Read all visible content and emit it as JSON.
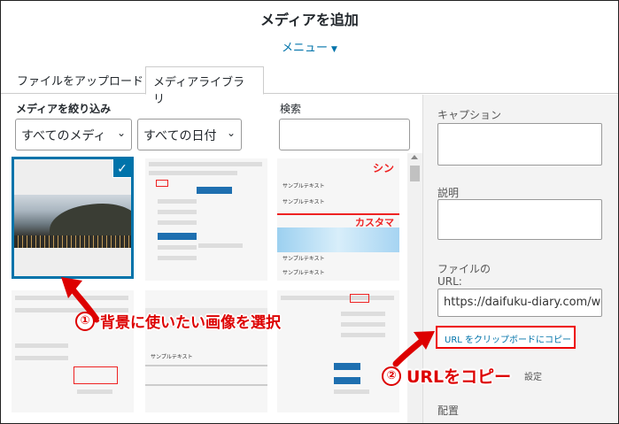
{
  "header": {
    "title": "メディアを追加",
    "menu_label": "メニュー",
    "menu_caret": "▼"
  },
  "tabs": [
    {
      "label": "ファイルをアップロード",
      "active": false
    },
    {
      "label": "メディアライブラリ",
      "active": true
    }
  ],
  "filters": {
    "label": "メディアを絞り込み",
    "type_select": "すべてのメディ",
    "date_select": "すべての日付",
    "chevron": "⌄"
  },
  "search": {
    "label": "検索",
    "value": ""
  },
  "thumbs": {
    "sample_text": "サンプルテキスト",
    "red_heading_1": "シン",
    "red_heading_2": "カスタマ",
    "check_glyph": "✓"
  },
  "sidebar": {
    "caption_label": "キャプション",
    "description_label": "説明",
    "file_url_label_1": "ファイルの",
    "file_url_label_2": "URL:",
    "file_url_value": "https://daifuku-diary.com/wp",
    "copy_button": "URL をクリップボードにコピー",
    "partial_label": "設定",
    "align_label": "配置"
  },
  "annotations": [
    {
      "number": "①",
      "text": "背景に使いたい画像を選択"
    },
    {
      "number": "②",
      "text": "URLをコピー"
    }
  ],
  "colors": {
    "accent": "#0073aa",
    "annotation_red": "#dd0000"
  }
}
